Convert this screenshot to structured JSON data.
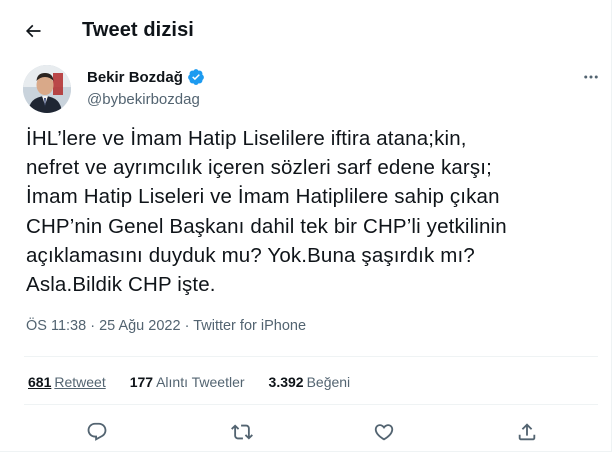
{
  "header": {
    "title": "Tweet dizisi",
    "back_icon": "arrow-left-icon"
  },
  "author": {
    "name": "Bekir Bozdağ",
    "handle": "@bybekirbozdag",
    "verified_icon": "verified-badge-icon",
    "more_icon": "more-horizontal-icon"
  },
  "tweet": {
    "lines": [
      "İHL’lere ve İmam Hatip Liselilere iftira atana;kin,",
      "nefret ve ayrımcılık içeren sözleri sarf edene karşı;",
      "İmam Hatip Liseleri ve İmam Hatiplilere sahip çıkan",
      "CHP’nin Genel Başkanı dahil tek bir CHP’li yetkilinin",
      "açıklamasını duyduk mu? Yok.Buna şaşırdık mı?",
      "Asla.Bildik CHP işte."
    ],
    "time": "ÖS 11:38",
    "separator": "·",
    "date": "25 Ağu 2022",
    "source": "Twitter for iPhone"
  },
  "stats": {
    "retweets_count": "681",
    "retweets_label": "Retweet",
    "quotes_count": "177",
    "quotes_label": "Alıntı Tweetler",
    "likes_count": "3.392",
    "likes_label": "Beğeni"
  },
  "actions": [
    "reply-icon",
    "retweet-icon",
    "like-icon",
    "share-icon"
  ],
  "colors": {
    "verified": "#1d9bf0",
    "text": "#0f1419",
    "secondary": "#536471",
    "divider": "#eff3f4"
  }
}
